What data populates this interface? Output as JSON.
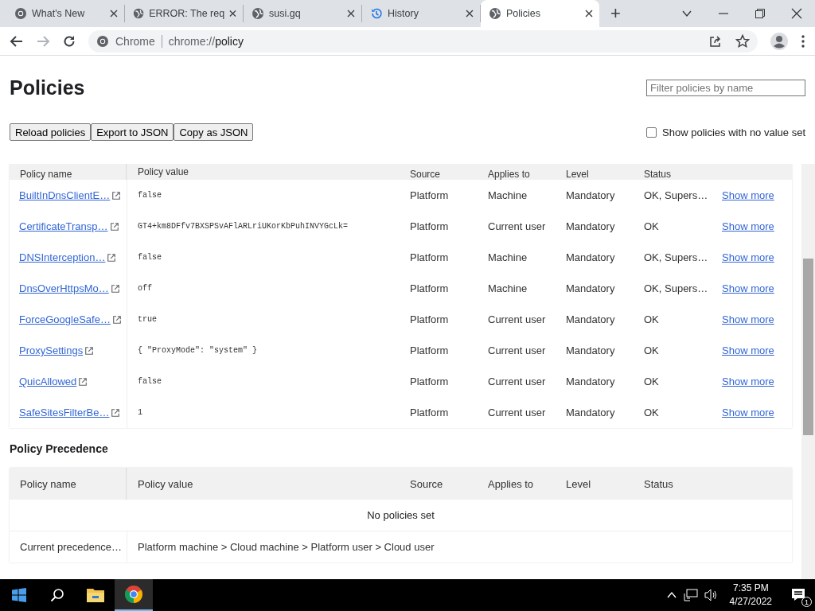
{
  "browser": {
    "tabs": [
      {
        "title": "What's New",
        "kind": "chrome",
        "selected": false
      },
      {
        "title": "ERROR: The req",
        "kind": "web",
        "selected": false
      },
      {
        "title": "susi.gq",
        "kind": "web",
        "selected": false
      },
      {
        "title": "History",
        "kind": "history",
        "selected": false
      },
      {
        "title": "Policies",
        "kind": "web",
        "selected": true
      }
    ],
    "new_tab": "+",
    "address": {
      "site": "Chrome",
      "scheme": "chrome://",
      "path": "policy"
    }
  },
  "page": {
    "title": "Policies",
    "filter": {
      "placeholder": "Filter policies by name"
    },
    "buttons": [
      "Reload policies",
      "Export to JSON",
      "Copy as JSON"
    ],
    "no_value_toggle": {
      "label": "Show policies with no value set",
      "checked": false
    },
    "policies": {
      "columns": [
        "Policy name",
        "Policy value",
        "Source",
        "Applies to",
        "Level",
        "Status"
      ],
      "rows": [
        {
          "name": "BuiltInDnsClientE…",
          "value": "false",
          "source": "Platform",
          "applies_to": "Machine",
          "level": "Mandatory",
          "status": "OK, Supers…",
          "action": "Show more"
        },
        {
          "name": "CertificateTransp…",
          "value": "GT4+km8DFfv7BXSPSvAFlARLriUKorKbPuhINVYGcLk=",
          "source": "Platform",
          "applies_to": "Current user",
          "level": "Mandatory",
          "status": "OK",
          "action": "Show more"
        },
        {
          "name": "DNSInterception…",
          "value": "false",
          "source": "Platform",
          "applies_to": "Machine",
          "level": "Mandatory",
          "status": "OK, Supers…",
          "action": "Show more"
        },
        {
          "name": "DnsOverHttpsMo…",
          "value": "off",
          "source": "Platform",
          "applies_to": "Machine",
          "level": "Mandatory",
          "status": "OK, Supers…",
          "action": "Show more"
        },
        {
          "name": "ForceGoogleSafe…",
          "value": "true",
          "source": "Platform",
          "applies_to": "Current user",
          "level": "Mandatory",
          "status": "OK",
          "action": "Show more"
        },
        {
          "name": "ProxySettings",
          "value": "{ \"ProxyMode\": \"system\" }",
          "source": "Platform",
          "applies_to": "Current user",
          "level": "Mandatory",
          "status": "OK",
          "action": "Show more"
        },
        {
          "name": "QuicAllowed",
          "value": "false",
          "source": "Platform",
          "applies_to": "Current user",
          "level": "Mandatory",
          "status": "OK",
          "action": "Show more"
        },
        {
          "name": "SafeSitesFilterBe…",
          "value": "1",
          "source": "Platform",
          "applies_to": "Current user",
          "level": "Mandatory",
          "status": "OK",
          "action": "Show more"
        }
      ]
    },
    "precedence": {
      "heading": "Policy Precedence",
      "columns": [
        "Policy name",
        "Policy value",
        "Source",
        "Applies to",
        "Level",
        "Status"
      ],
      "empty_message": "No policies set",
      "rows": [
        {
          "name": "Current precedence…",
          "value": "Platform machine > Cloud machine > Platform user > Cloud user"
        }
      ]
    }
  },
  "taskbar": {
    "time": "7:35 PM",
    "date": "4/27/2022",
    "notifications": "1"
  }
}
